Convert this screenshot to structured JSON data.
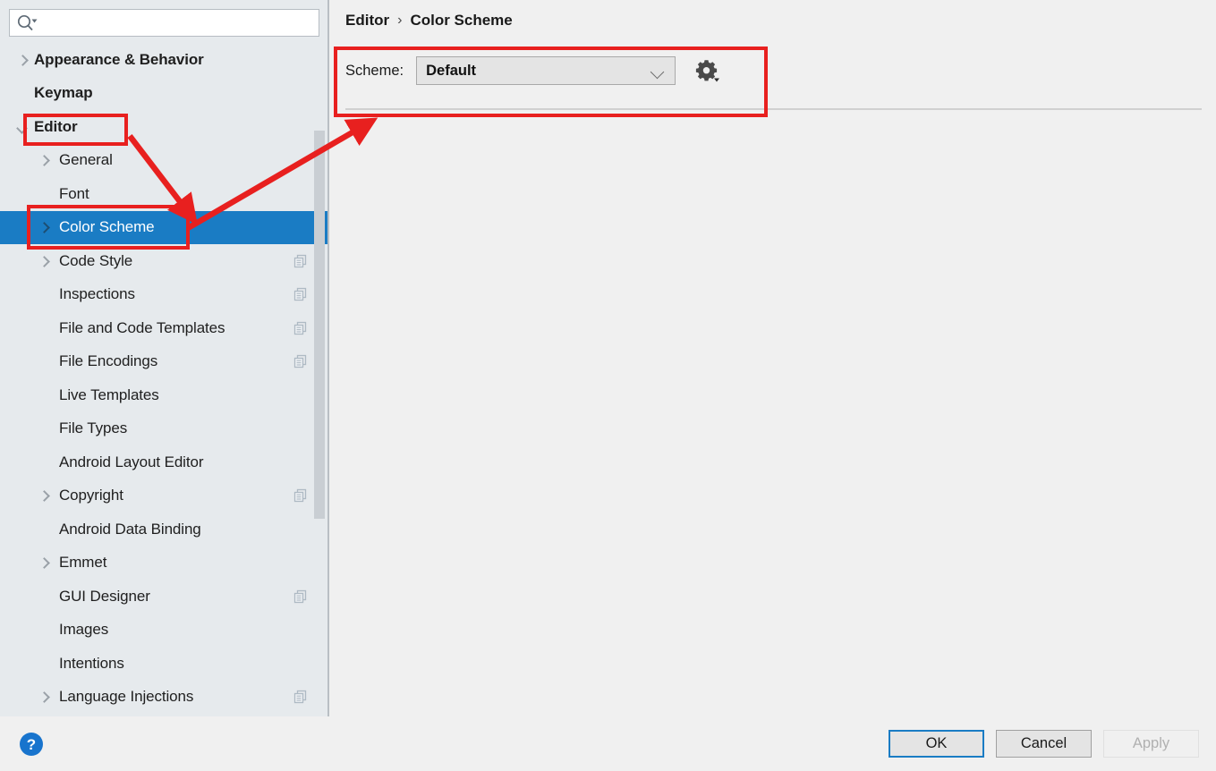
{
  "search": {
    "placeholder": "",
    "value": "",
    "icon": "search-icon"
  },
  "sidebar": {
    "items": [
      {
        "label": "Appearance & Behavior",
        "level": 0,
        "arrow": "right",
        "bold": true,
        "selected": false,
        "copy": false
      },
      {
        "label": "Keymap",
        "level": 0,
        "arrow": "none",
        "bold": true,
        "selected": false,
        "copy": false
      },
      {
        "label": "Editor",
        "level": 0,
        "arrow": "down",
        "bold": true,
        "selected": false,
        "copy": false
      },
      {
        "label": "General",
        "level": 1,
        "arrow": "right",
        "bold": false,
        "selected": false,
        "copy": false
      },
      {
        "label": "Font",
        "level": 1,
        "arrow": "none",
        "bold": false,
        "selected": false,
        "copy": false
      },
      {
        "label": "Color Scheme",
        "level": 1,
        "arrow": "right",
        "bold": false,
        "selected": true,
        "copy": false
      },
      {
        "label": "Code Style",
        "level": 1,
        "arrow": "right",
        "bold": false,
        "selected": false,
        "copy": true
      },
      {
        "label": "Inspections",
        "level": 1,
        "arrow": "none",
        "bold": false,
        "selected": false,
        "copy": true
      },
      {
        "label": "File and Code Templates",
        "level": 1,
        "arrow": "none",
        "bold": false,
        "selected": false,
        "copy": true
      },
      {
        "label": "File Encodings",
        "level": 1,
        "arrow": "none",
        "bold": false,
        "selected": false,
        "copy": true
      },
      {
        "label": "Live Templates",
        "level": 1,
        "arrow": "none",
        "bold": false,
        "selected": false,
        "copy": false
      },
      {
        "label": "File Types",
        "level": 1,
        "arrow": "none",
        "bold": false,
        "selected": false,
        "copy": false
      },
      {
        "label": "Android Layout Editor",
        "level": 1,
        "arrow": "none",
        "bold": false,
        "selected": false,
        "copy": false
      },
      {
        "label": "Copyright",
        "level": 1,
        "arrow": "right",
        "bold": false,
        "selected": false,
        "copy": true
      },
      {
        "label": "Android Data Binding",
        "level": 1,
        "arrow": "none",
        "bold": false,
        "selected": false,
        "copy": false
      },
      {
        "label": "Emmet",
        "level": 1,
        "arrow": "right",
        "bold": false,
        "selected": false,
        "copy": false
      },
      {
        "label": "GUI Designer",
        "level": 1,
        "arrow": "none",
        "bold": false,
        "selected": false,
        "copy": true
      },
      {
        "label": "Images",
        "level": 1,
        "arrow": "none",
        "bold": false,
        "selected": false,
        "copy": false
      },
      {
        "label": "Intentions",
        "level": 1,
        "arrow": "none",
        "bold": false,
        "selected": false,
        "copy": false
      },
      {
        "label": "Language Injections",
        "level": 1,
        "arrow": "right",
        "bold": false,
        "selected": false,
        "copy": true
      }
    ]
  },
  "content": {
    "breadcrumb": {
      "parent": "Editor",
      "separator": "›",
      "current": "Color Scheme"
    },
    "scheme": {
      "label": "Scheme:",
      "value": "Default",
      "options": [
        "Default"
      ],
      "chevron_icon": "chevron-down-icon",
      "gear_icon": "gear-icon"
    }
  },
  "bottom_bar": {
    "help_label": "?",
    "help_icon": "help-icon",
    "ok_label": "OK",
    "cancel_label": "Cancel",
    "apply_label": "Apply",
    "apply_enabled": false
  },
  "annotations": {
    "color": "#e8201f",
    "boxes": [
      "Editor",
      "Color Scheme",
      "Scheme: Default"
    ],
    "arrows": 2
  },
  "colors": {
    "selection_blue": "#1a7cc4",
    "sidebar_bg": "#e6eaed",
    "panel_bg": "#f0f0f0",
    "annotation_red": "#e8201f",
    "help_blue": "#1874cd"
  }
}
